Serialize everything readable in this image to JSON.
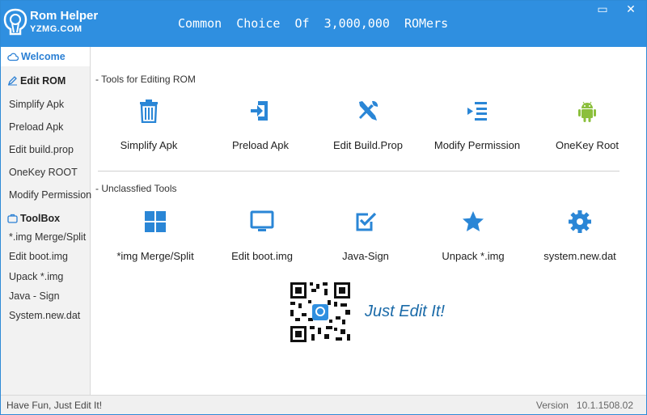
{
  "app": {
    "logo_title": "Rom Helper",
    "logo_sub": "YZMG.COM",
    "slogan": "Common  Choice  Of  3,000,000  ROMers",
    "minimize_glyph": "▭",
    "close_glyph": "✕"
  },
  "sidebar": {
    "welcome": "Welcome",
    "edit_rom_header": "Edit ROM",
    "edit_items": [
      "Simplify Apk",
      "Preload Apk",
      "Edit build.prop",
      "OneKey ROOT",
      "Modify Permission"
    ],
    "toolbox_header": "ToolBox",
    "toolbox_items": [
      "*.img Merge/Split",
      "Edit boot.img",
      "Upack  *.img",
      "Java - Sign",
      "System.new.dat"
    ]
  },
  "main": {
    "section_edit_title": "- Tools for Editing ROM",
    "edit_tools": [
      {
        "label": "Simplify Apk",
        "icon": "trash-icon"
      },
      {
        "label": "Preload Apk",
        "icon": "login-arrow-icon"
      },
      {
        "label": "Edit Build.Prop",
        "icon": "tools-icon"
      },
      {
        "label": "Modify Permission",
        "icon": "list-indent-icon"
      },
      {
        "label": "OneKey Root",
        "icon": "android-icon"
      }
    ],
    "section_unclassified_title": "- Unclassfied Tools",
    "other_tools": [
      {
        "label": "*img Merge/Split",
        "icon": "grid-icon"
      },
      {
        "label": "Edit boot.img",
        "icon": "monitor-icon"
      },
      {
        "label": "Java-Sign",
        "icon": "check-square-icon"
      },
      {
        "label": "Unpack *.img",
        "icon": "star-icon"
      },
      {
        "label": "system.new.dat",
        "icon": "gear-icon"
      }
    ],
    "tagline": "Just Edit It!"
  },
  "status": {
    "left": "Have Fun, Just Edit It!",
    "right": "Version   10.1.1508.02"
  },
  "colors": {
    "accent": "#2f8fe0",
    "icon_blue": "#2a86d6",
    "android_green": "#8bbf3c"
  }
}
